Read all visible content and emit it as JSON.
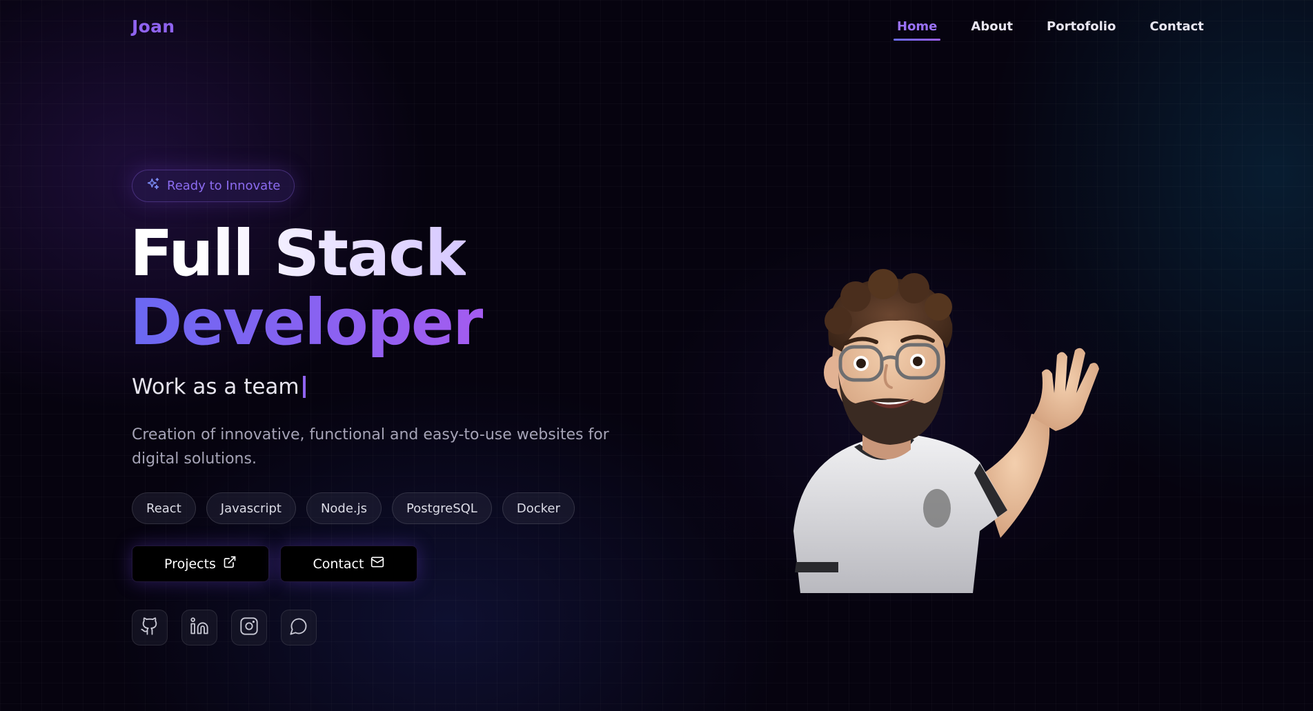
{
  "brand": {
    "logo": "Joan",
    "accent": "#8f63f0"
  },
  "nav": {
    "items": [
      {
        "label": "Home",
        "active": true
      },
      {
        "label": "About",
        "active": false
      },
      {
        "label": "Portofolio",
        "active": false
      },
      {
        "label": "Contact",
        "active": false
      }
    ]
  },
  "hero": {
    "badge": {
      "icon": "sparkles-icon",
      "label": "Ready to Innovate"
    },
    "title_line1": "Full Stack",
    "title_line2": "Developer",
    "typed_text": "Work as a team",
    "description": "Creation of innovative, functional and easy-to-use websites for digital solutions.",
    "tags": [
      "React",
      "Javascript",
      "Node.js",
      "PostgreSQL",
      "Docker"
    ],
    "buttons": [
      {
        "label": "Projects",
        "icon": "external-link-icon"
      },
      {
        "label": "Contact",
        "icon": "mail-icon"
      }
    ],
    "socials": [
      {
        "icon": "github-icon"
      },
      {
        "icon": "linkedin-icon"
      },
      {
        "icon": "instagram-icon"
      },
      {
        "icon": "chat-bubble-icon"
      }
    ],
    "illustration": "waving-memoji-avatar"
  }
}
